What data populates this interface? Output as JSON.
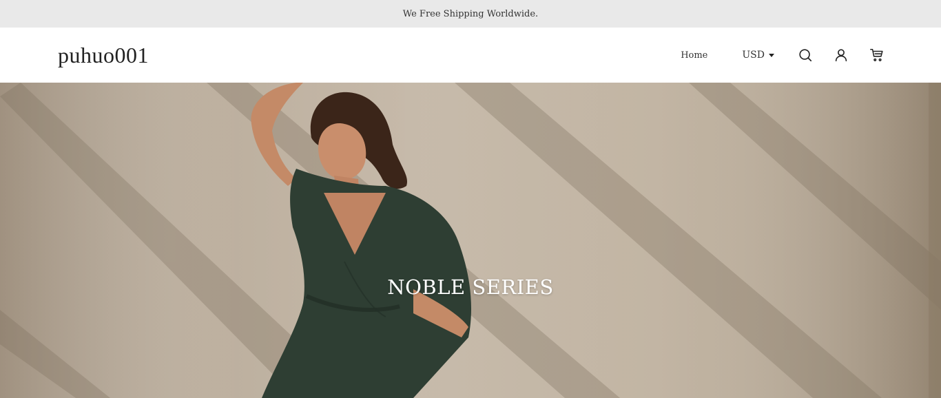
{
  "announcement": {
    "text": "We Free Shipping Worldwide."
  },
  "header": {
    "logo": "puhuo001",
    "nav": {
      "home": "Home"
    },
    "currency": "USD",
    "icons": [
      "search-icon",
      "account-icon",
      "cart-icon"
    ]
  },
  "hero": {
    "title": "NOBLE SERIES"
  },
  "colors": {
    "announcement_bg": "#e9e9e9",
    "wall": "#c3b6a5",
    "dress": "#2e3e33",
    "skin": "#c98e6c",
    "text_light": "#ffffff"
  }
}
